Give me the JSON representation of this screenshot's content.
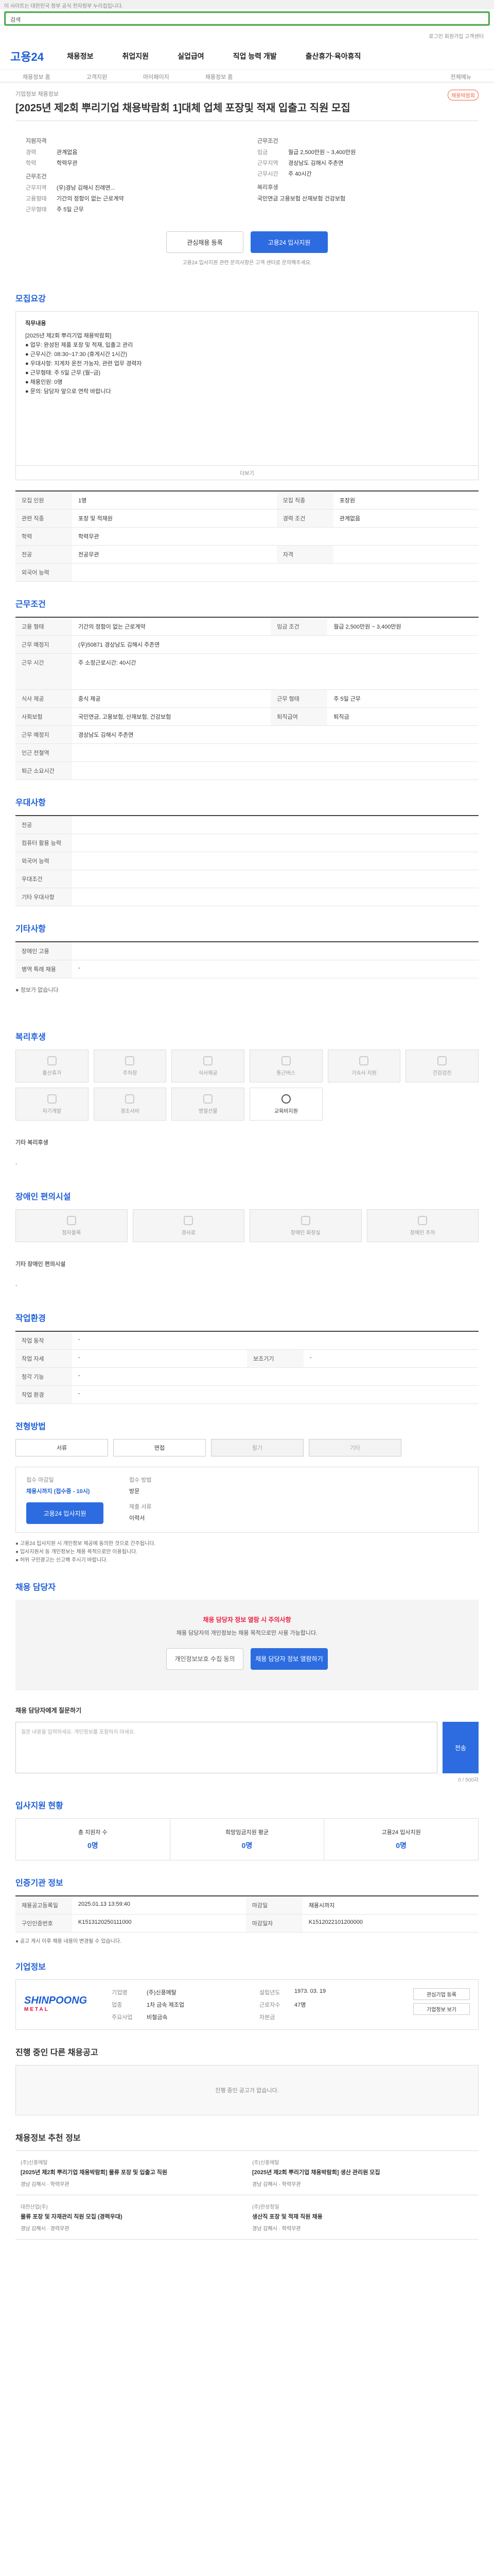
{
  "topbar": {
    "text": "이 사이트는 대한민국 정부 공식 전자정부 누리집입니다."
  },
  "search": {
    "placeholder": "검색"
  },
  "util": {
    "links": "로그인 회원가입 고객센터"
  },
  "logo": "고용24",
  "gnb": [
    "채용정보",
    "취업지원",
    "실업급여",
    "직업 능력 개발",
    "출산휴가·육아휴직"
  ],
  "subnav": [
    "채용정보 홈",
    "고객지원",
    "마이페이지",
    "채용정보 홈",
    "전체메뉴"
  ],
  "job": {
    "category": "기업정보 채용정보",
    "title": "[2025년 제2회 뿌리기업 채용박람회 1]대체 업체 포장및 적재 입출고 직원 모집",
    "tag": "채용박람회"
  },
  "summary": {
    "left_h": "지원자격",
    "left": [
      [
        "경력",
        "관계없음"
      ],
      [
        "학력",
        "학력무관"
      ]
    ],
    "left_h2": "근무조건",
    "left2": [
      [
        "근무지역",
        "(우)경남 김해시 진례면..."
      ],
      [
        "고용형태",
        "기간의 정함이 없는 근로계약"
      ],
      [
        "근무형태",
        "주 5일 근무"
      ]
    ],
    "right_h": "근무조건",
    "right": [
      [
        "임금",
        "월급 2,500만원 ~ 3,400만원"
      ],
      [
        "근무지역",
        "경상남도 김해시 주촌면"
      ],
      [
        "근무시간",
        "주 40시간"
      ]
    ],
    "right_h2": "복리후생",
    "right2": [
      [
        "",
        "국민연금 고용보험 산재보험 건강보험"
      ]
    ]
  },
  "buttons": {
    "scrap": "관심채용 등록",
    "apply": "고용24 입사지원"
  },
  "note": "고용24 입사지원 관련 문의사항은 고객 센터로 문의해주세요.",
  "detail": {
    "heading": "모집요강",
    "lines": [
      "직무내용",
      "[2025년 제2회 뿌리기업 채용박람회]",
      "● 업무: 완성된 제품 포장 및 적재, 입출고 관리",
      "● 근무시간: 08:30~17:30 (휴게시간 1시간)",
      "● 우대사항: 지게차 운전 가능자, 관련 업무 경력자",
      "● 근무형태: 주 5일 근무 (월~금)",
      "● 채용인원: 0명",
      "● 문의: 담당자 앞으로 연락 바랍니다"
    ],
    "more": "더보기"
  },
  "req_table": [
    [
      "모집 인원",
      "1명",
      "모집 직종",
      "포장원"
    ],
    [
      "관련 직종",
      "포장 및 적재원",
      "경력 조건",
      "관계없음"
    ],
    [
      "학력",
      "학력무관",
      "",
      ""
    ],
    [
      "전공",
      "전공무관",
      "자격",
      ""
    ],
    [
      "외국어 능력",
      "",
      "",
      ""
    ]
  ],
  "cond": {
    "heading": "근무조건",
    "rows": [
      [
        "고용 형태",
        "기간의 정함이 없는 근로계약",
        "임금 조건",
        "월급 2,500만원 ~ 3,400만원"
      ],
      [
        "근무 예정지",
        "(우)50871 경상남도 김해시 주촌면",
        "",
        ""
      ],
      [
        "근무 시간",
        "주 소정근로시간: 40시간",
        "",
        ""
      ],
      [
        "식사 제공",
        "중식 제공",
        "근무 형태",
        "주 5일 근무"
      ],
      [
        "사회보험",
        "국민연금, 고용보험, 산재보험, 건강보험",
        "퇴직급여",
        "퇴직금"
      ],
      [
        "근무 예정지",
        "경상남도 김해시 주촌면",
        "",
        ""
      ],
      [
        "인근 전철역",
        "",
        "",
        ""
      ],
      [
        "퇴근 소요시간",
        "",
        "",
        ""
      ]
    ]
  },
  "pref": {
    "heading": "우대사항",
    "rows": [
      [
        "전공",
        ""
      ],
      [
        "컴퓨터 활용 능력",
        ""
      ],
      [
        "외국어 능력",
        ""
      ],
      [
        "우대조건",
        ""
      ],
      [
        "기타 우대사항",
        ""
      ]
    ]
  },
  "etc": {
    "heading": "기타사항",
    "rows": [
      [
        "장애인 고용",
        ""
      ],
      [
        "병역 특례 채용",
        "-"
      ]
    ],
    "note": "● 정보가 없습니다"
  },
  "welfare": {
    "heading": "복리후생",
    "items": [
      "출산휴가",
      "주차장",
      "식사제공",
      "통근버스",
      "기숙사 지원",
      "건강검진",
      "자기개발",
      "경조사비",
      "명절선물",
      "교육비지원",
      "휴가지원",
      "포상휴가"
    ],
    "other_h": "기타 복리후생",
    "other": "-"
  },
  "disabled": {
    "heading": "장애인 편의시설",
    "items": [
      "점자블록",
      "경사로",
      "장애인 화장실",
      "장애인 주차"
    ],
    "other_h": "기타 장애인 편의시설",
    "other": "-"
  },
  "env": {
    "heading": "작업환경",
    "rows": [
      [
        "작업 동작",
        "-",
        "",
        ""
      ],
      [
        "작업 자세",
        "-",
        "보조기기",
        "-"
      ],
      [
        "청각 기능",
        "-",
        "",
        ""
      ],
      [
        "작업 환경",
        "-",
        "",
        ""
      ]
    ]
  },
  "apply": {
    "heading": "전형방법",
    "methods": [
      "서류",
      "면접",
      "필기",
      "기타"
    ],
    "deadline_l": "접수 마감일",
    "deadline": "채용시까지 (접수중 - 10시)",
    "method_l": "접수 방법",
    "method": "방문",
    "docs_l": "제출 서류",
    "docs": "이력서",
    "btn": "고용24 입사지원"
  },
  "notice": [
    "● 고용24 입사지원 시 개인정보 제공에 동의한 것으로 간주됩니다.",
    "● 입사지원서 등 개인정보는 채용 목적으로만 이용됩니다.",
    "● 허위 구인광고는 신고해 주시기 바랍니다."
  ],
  "manager": {
    "heading": "채용 담당자",
    "warn_t": "채용 담당자 정보 열람 시 주의사항",
    "warn": "채용 담당자의 개인정보는 채용 목적으로만 사용 가능합니다.",
    "b1": "개인정보보호 수집 동의",
    "b2": "채용 담당자 정보 열람하기"
  },
  "comment": {
    "heading": "채용 담당자에게 질문하기",
    "placeholder": "질문 내용을 입력하세요. 개인정보를 포함하지 마세요.",
    "submit": "전송",
    "counter": "0 / 500자"
  },
  "stats": {
    "heading": "입사지원 현황",
    "items": [
      [
        "총 지원자 수",
        "0명"
      ],
      [
        "희망임금지원 평균",
        "0명"
      ],
      [
        "고용24 입사지원",
        "0명"
      ]
    ]
  },
  "jobinfo": {
    "heading": "인증기관 정보",
    "rows": [
      [
        "채용공고등록일",
        "2025.01.13 13:59:40",
        "마감일",
        "채용시까지"
      ],
      [
        "구인인증번호",
        "K1513120250111000",
        "마감일자",
        "K1512022101200000"
      ]
    ],
    "note": "● 공고 게시 이후 채용 내용이 변경될 수 있습니다."
  },
  "company": {
    "heading": "기업정보",
    "logo_a": "SHINPOONG",
    "logo_b": "METAL",
    "rows": [
      [
        "기업명",
        "(주)신풍메탈",
        "설립년도",
        "1973. 03. 19"
      ],
      [
        "업종",
        "1차 금속 제조업",
        "근로자수",
        "47명"
      ],
      [
        "주요사업",
        "비철금속",
        "자본금",
        ""
      ]
    ],
    "b1": "관심기업 등록",
    "b2": "기업정보 보기"
  },
  "others": {
    "heading": "진행 중인 다른 채용공고",
    "empty": "진행 중인 공고가 없습니다."
  },
  "similar": {
    "heading": "채용정보 추천 정보",
    "items": [
      {
        "c": "(주)신풍메탈",
        "t": "[2025년 제2회 뿌리기업 채용박람회] 물류 포장 및 입출고 직원",
        "m": "경남 김해시 · 학력무관"
      },
      {
        "c": "(주)신풍메탈",
        "t": "[2025년 제2회 뿌리기업 채용박람회] 생산 관리원 모집",
        "m": "경남 김해시 · 학력무관"
      },
      {
        "c": "대한산업(주)",
        "t": "물류 포장 및 자재관리 직원 모집 (경력우대)",
        "m": "경남 김해시 · 경력무관"
      },
      {
        "c": "(주)한성정밀",
        "t": "생산직 포장 및 적재 직원 채용",
        "m": "경남 김해시 · 학력무관"
      }
    ]
  }
}
